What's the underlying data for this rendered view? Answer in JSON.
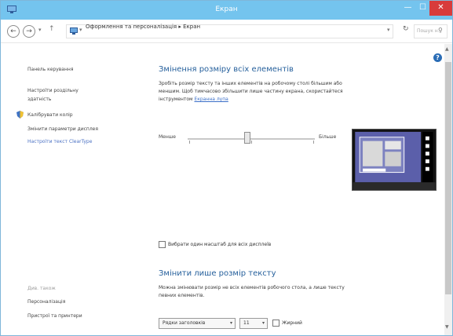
{
  "window": {
    "title": "Екран"
  },
  "nav": {
    "breadcrumb": [
      "Оформлення та персоналізація",
      "Екран"
    ],
    "search_placeholder": "Пошук н...",
    "back_glyph": "←",
    "forward_glyph": "→",
    "down_glyph": "▾",
    "up_glyph": "↑",
    "refresh_glyph": "↻"
  },
  "sidebar": {
    "items": [
      "Панель керування",
      "Настроїти роздільну",
      "здатність",
      "Калібрувати колір",
      "Змінити параметри дисплея",
      "Настроїти текст ClearType"
    ],
    "see_also": "Див. також",
    "see_also_items": [
      "Персоналізація",
      "Пристрої та принтери"
    ]
  },
  "main": {
    "heading1": "Змінення розміру всіх елементів",
    "desc1_line1": "Зробіть розмір тексту та інших елементів на робочому столі більшим або",
    "desc1_line2": "меншим. Щоб тимчасово збільшити лише частину екрана, скористайтеся",
    "desc1_line3_prefix": "інструментом",
    "desc1_link": "Екранна лупа",
    "slider_min_label": "Менше",
    "slider_max_label": "Більше",
    "slider_level": 0.47,
    "checkbox_one_scale": "Вибрати один масштаб для всіх дисплеїв",
    "heading2": "Змінити лише розмір тексту",
    "desc2_line1": "Можна змінювати розмір не всіх елементів робочого стола, а лише тексту",
    "desc2_line2": "певних елементів.",
    "element_select": "Рядки заголовків",
    "size_select": "11",
    "bold_label": "Жирний"
  },
  "icons": {
    "help": "?",
    "close": "✕",
    "minimize": "—",
    "maximize": "☐",
    "search": "⚲",
    "scroll_up": "▲",
    "scroll_down": "▼",
    "select_arrow": "▾"
  },
  "colors": {
    "titlebar": "#74c4ee",
    "close": "#d83b3b",
    "heading": "#26609c",
    "link": "#3b6fc8"
  }
}
